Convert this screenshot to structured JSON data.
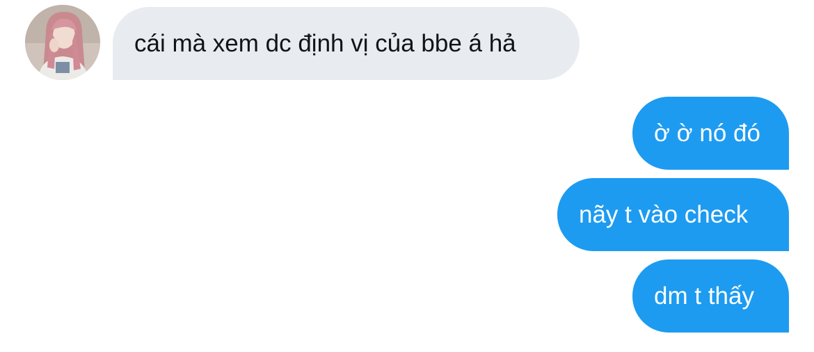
{
  "conversation": {
    "incoming_avatar_icon": "user-avatar-photo",
    "messages": [
      {
        "direction": "incoming",
        "text": "cái mà xem dc định vị của bbe á hả"
      },
      {
        "direction": "outgoing",
        "text": "ờ ờ nó đó"
      },
      {
        "direction": "outgoing",
        "text": "nãy t vào check"
      },
      {
        "direction": "outgoing",
        "text": "dm t thấy"
      }
    ]
  },
  "colors": {
    "incoming_bubble": "#e8ecf0",
    "incoming_text": "#0f1419",
    "outgoing_bubble": "#1d9bf0",
    "outgoing_text": "#ffffff",
    "background": "#ffffff"
  }
}
